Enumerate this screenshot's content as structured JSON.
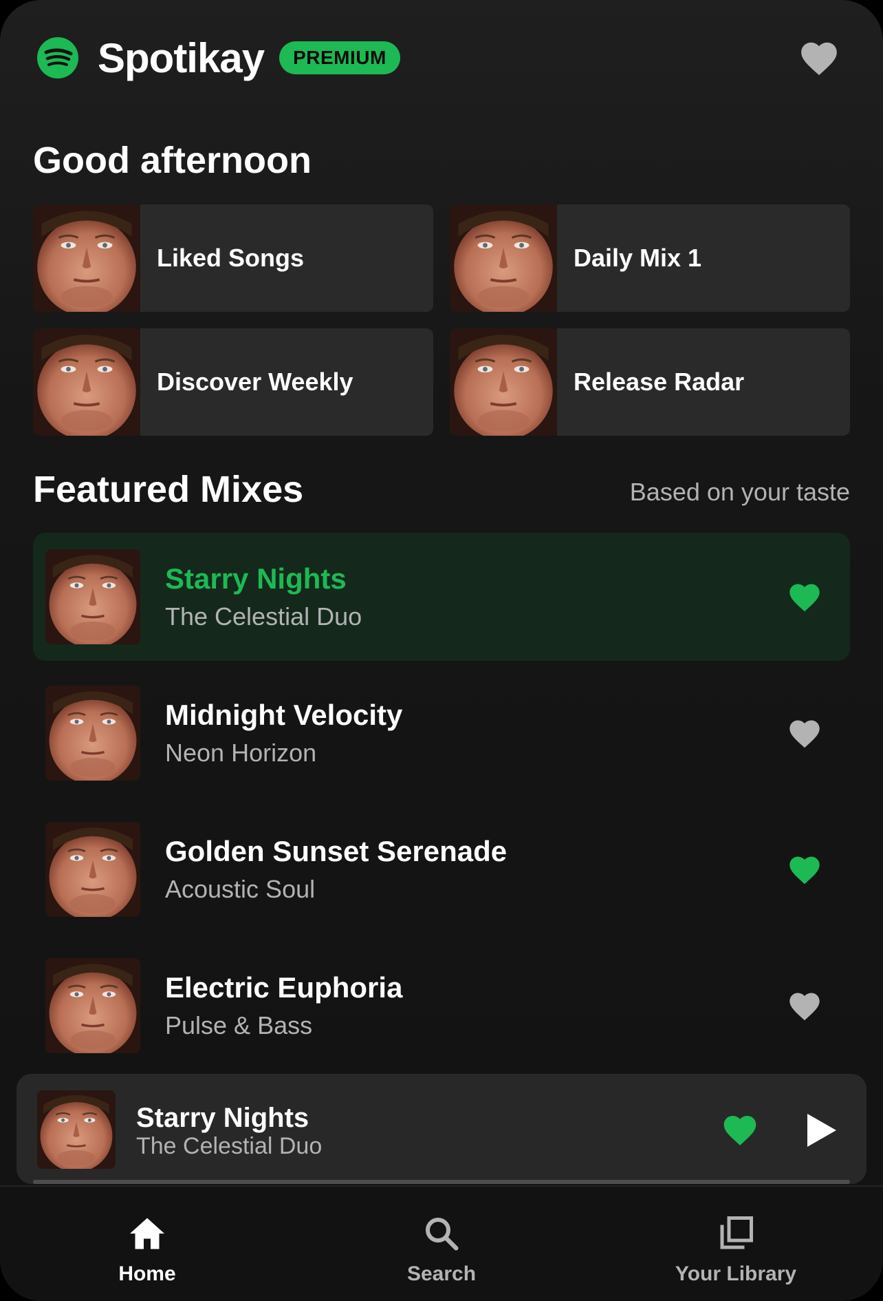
{
  "app": {
    "title": "Spotikay",
    "badge": "PREMIUM"
  },
  "colors": {
    "accent": "#1db954",
    "background": "#121212",
    "card": "#2a2a2a",
    "muted": "#b3b3b3"
  },
  "icons": {
    "logo": "spotify-logo-icon",
    "header_heart": "heart-icon"
  },
  "greeting": "Good afternoon",
  "quick_picks": [
    {
      "label": "Liked Songs"
    },
    {
      "label": "Daily Mix 1"
    },
    {
      "label": "Discover Weekly"
    },
    {
      "label": "Release Radar"
    }
  ],
  "featured": {
    "title": "Featured Mixes",
    "subtitle": "Based on your taste",
    "items": [
      {
        "title": "Starry Nights",
        "artist": "The Celestial Duo",
        "liked": true,
        "active": true
      },
      {
        "title": "Midnight Velocity",
        "artist": "Neon Horizon",
        "liked": false,
        "active": false
      },
      {
        "title": "Golden Sunset Serenade",
        "artist": "Acoustic Soul",
        "liked": true,
        "active": false
      },
      {
        "title": "Electric Euphoria",
        "artist": "Pulse & Bass",
        "liked": false,
        "active": false
      }
    ]
  },
  "player": {
    "title": "Starry Nights",
    "artist": "The Celestial Duo",
    "liked": true,
    "progress": 0.0
  },
  "nav": [
    {
      "label": "Home",
      "icon": "home-icon",
      "active": true
    },
    {
      "label": "Search",
      "icon": "search-icon",
      "active": false
    },
    {
      "label": "Your Library",
      "icon": "library-icon",
      "active": false
    }
  ]
}
